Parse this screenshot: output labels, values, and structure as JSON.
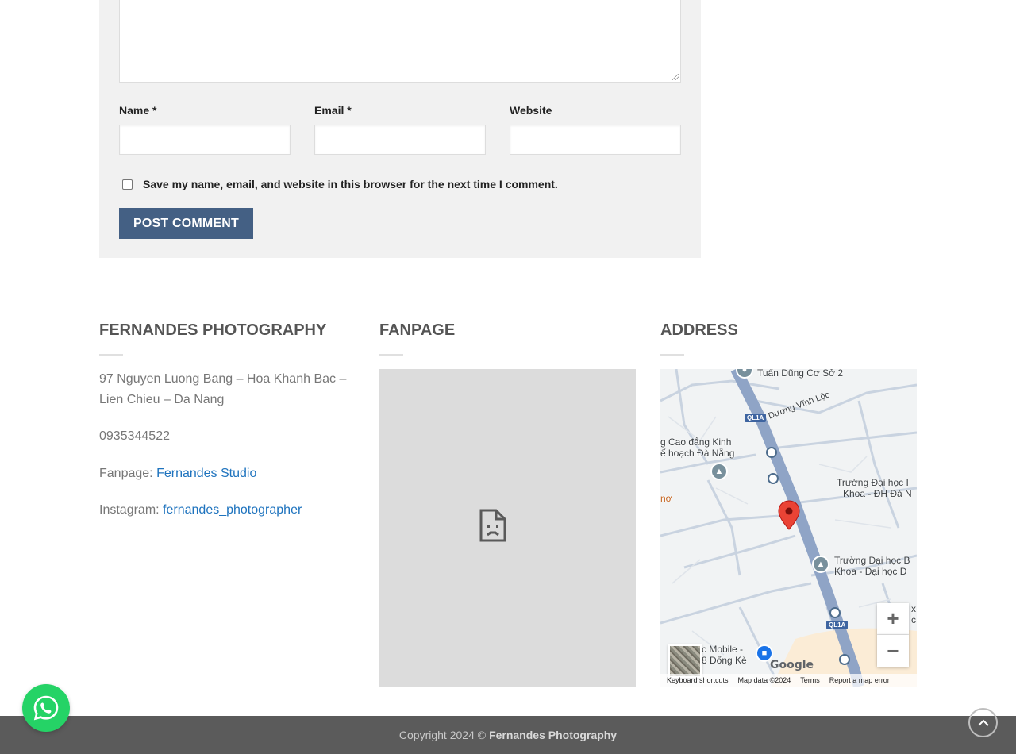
{
  "form": {
    "name_label": "Name *",
    "email_label": "Email *",
    "website_label": "Website",
    "consent_label": "Save my name, email, and website in this browser for the next time I comment.",
    "submit_label": "Post Comment"
  },
  "footer": {
    "columns": [
      {
        "title": "FERNANDES PHOTOGRAPHY"
      },
      {
        "title": "FANPAGE"
      },
      {
        "title": "ADDRESS"
      }
    ],
    "address": "97 Nguyen Luong Bang – Hoa Khanh Bac – Lien Chieu – Da Nang",
    "phone": "0935344522",
    "fanpage_prefix": "Fanpage:",
    "fanpage_link": "Fernandes Studio",
    "instagram_prefix": "Instagram:",
    "instagram_link": "fernandes_photographer",
    "copyright_prefix": "Copyright 2024 ©",
    "copyright_brand": "Fernandes Photography"
  },
  "map": {
    "labels": {
      "l1": "Tuấn Dũng Cơ Sở 2",
      "l2": "Dương Vĩnh Lộc",
      "l3": "g Cao đẳng Kinh",
      "l4": "ế hoạch Đà Nẵng",
      "l5": "Trường Đại học I",
      "l6": "Khoa - ĐH Đà N",
      "l7": "nơ",
      "l8": "Trường Đại học B",
      "l9": "Khoa - Đại học Đ",
      "l10": "c Mobile -",
      "l11": "8 Đống Kè",
      "l12": "x",
      "l13": "c"
    },
    "route": "QL1A",
    "zoom_in": "+",
    "zoom_out": "−",
    "logo": "Google",
    "footer": {
      "keyboard": "Keyboard shortcuts",
      "data": "Map data ©2024",
      "terms": "Terms",
      "report": "Report a map error"
    }
  },
  "colors": {
    "button": "#446084",
    "link": "#1e73be",
    "footer_bar": "#5b5b5b",
    "whatsapp": "#25d366",
    "pin": "#ea4335"
  },
  "icons": {
    "fanpage_placeholder": "broken-document-icon",
    "back_to_top": "chevron-up-icon",
    "chat": "whatsapp-icon"
  }
}
